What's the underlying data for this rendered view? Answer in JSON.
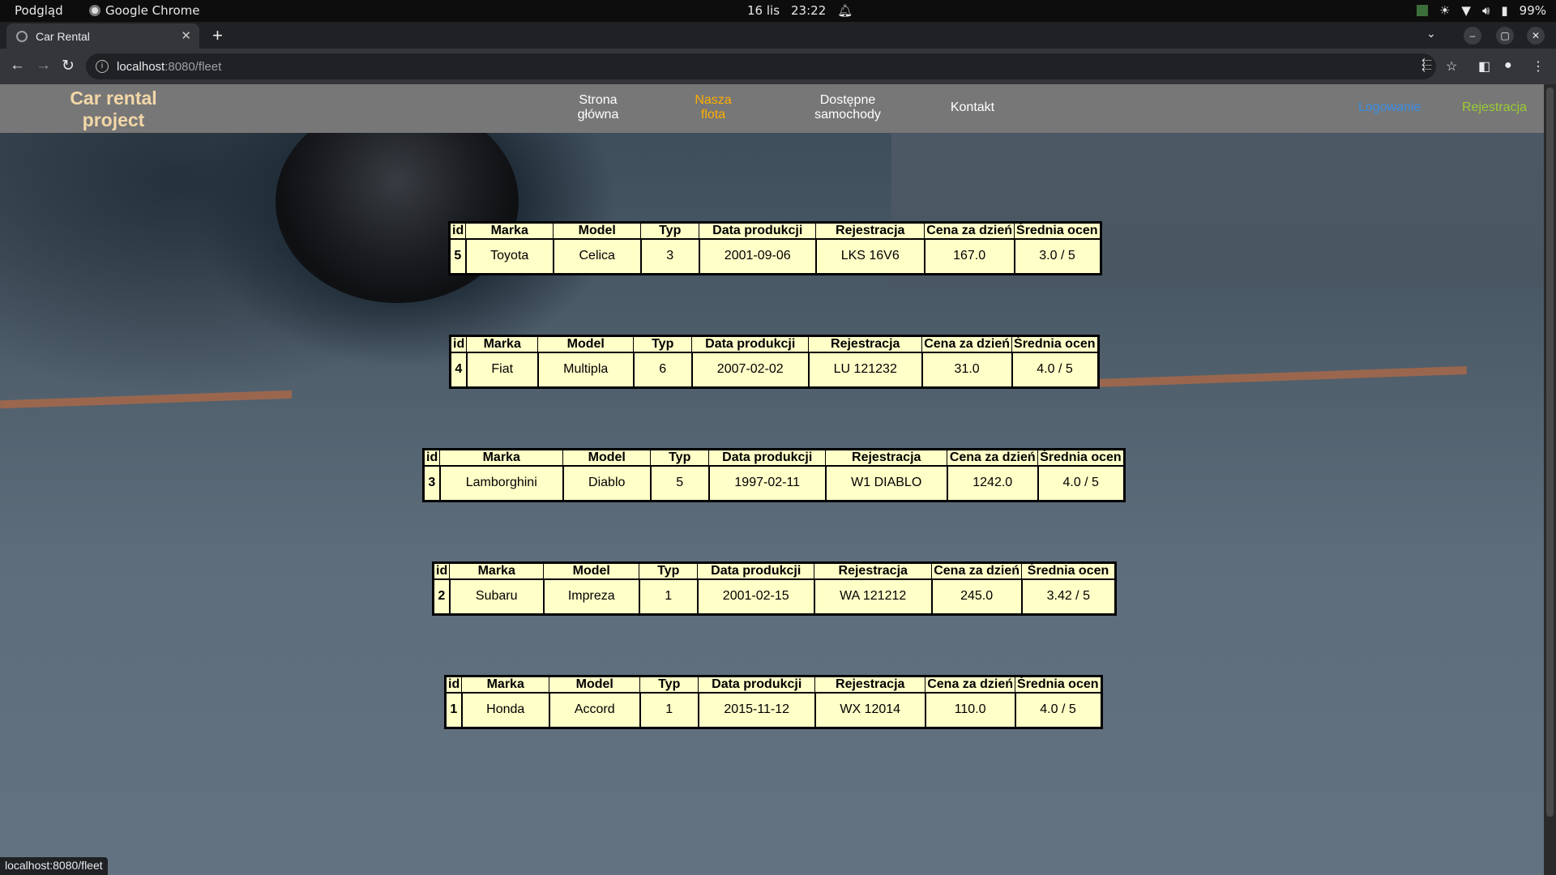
{
  "os": {
    "activities": "Podgląd",
    "app_name": "Google Chrome",
    "date": "16 lis",
    "time": "23:22",
    "battery": "99%"
  },
  "browser": {
    "tab_title": "Car Rental",
    "url_host": "localhost",
    "url_path": ":8080/fleet",
    "status_url": "localhost:8080/fleet"
  },
  "site": {
    "brand_line1": "Car rental",
    "brand_line2": "project",
    "nav": [
      {
        "line1": "Strona",
        "line2": "główna"
      },
      {
        "line1": "Nasza",
        "line2": "flota"
      },
      {
        "line1": "Dostępne",
        "line2": "samochody"
      },
      {
        "line1": "Kontakt",
        "line2": ""
      }
    ],
    "login": "Logowanie",
    "register": "Rejestracja"
  },
  "table_headers": [
    "id",
    "Marka",
    "Model",
    "Typ",
    "Data produkcji",
    "Rejestracja",
    "Cena za dzień",
    "Średnia ocen"
  ],
  "cars": [
    {
      "id": "5",
      "make": "Toyota",
      "model": "Celica",
      "type": "3",
      "production_date": "2001-09-06",
      "registration": "LKS 16V6",
      "price": "167.0",
      "rating": "3.0 / 5"
    },
    {
      "id": "4",
      "make": "Fiat",
      "model": "Multipla",
      "type": "6",
      "production_date": "2007-02-02",
      "registration": "LU 121232",
      "price": "31.0",
      "rating": "4.0 / 5"
    },
    {
      "id": "3",
      "make": "Lamborghini",
      "model": "Diablo",
      "type": "5",
      "production_date": "1997-02-11",
      "registration": "W1 DIABLO",
      "price": "1242.0",
      "rating": "4.0 / 5"
    },
    {
      "id": "2",
      "make": "Subaru",
      "model": "Impreza",
      "type": "1",
      "production_date": "2001-02-15",
      "registration": "WA 121212",
      "price": "245.0",
      "rating": "3.42 / 5"
    },
    {
      "id": "1",
      "make": "Honda",
      "model": "Accord",
      "type": "1",
      "production_date": "2015-11-12",
      "registration": "WX 12014",
      "price": "110.0",
      "rating": "4.0 / 5"
    }
  ]
}
